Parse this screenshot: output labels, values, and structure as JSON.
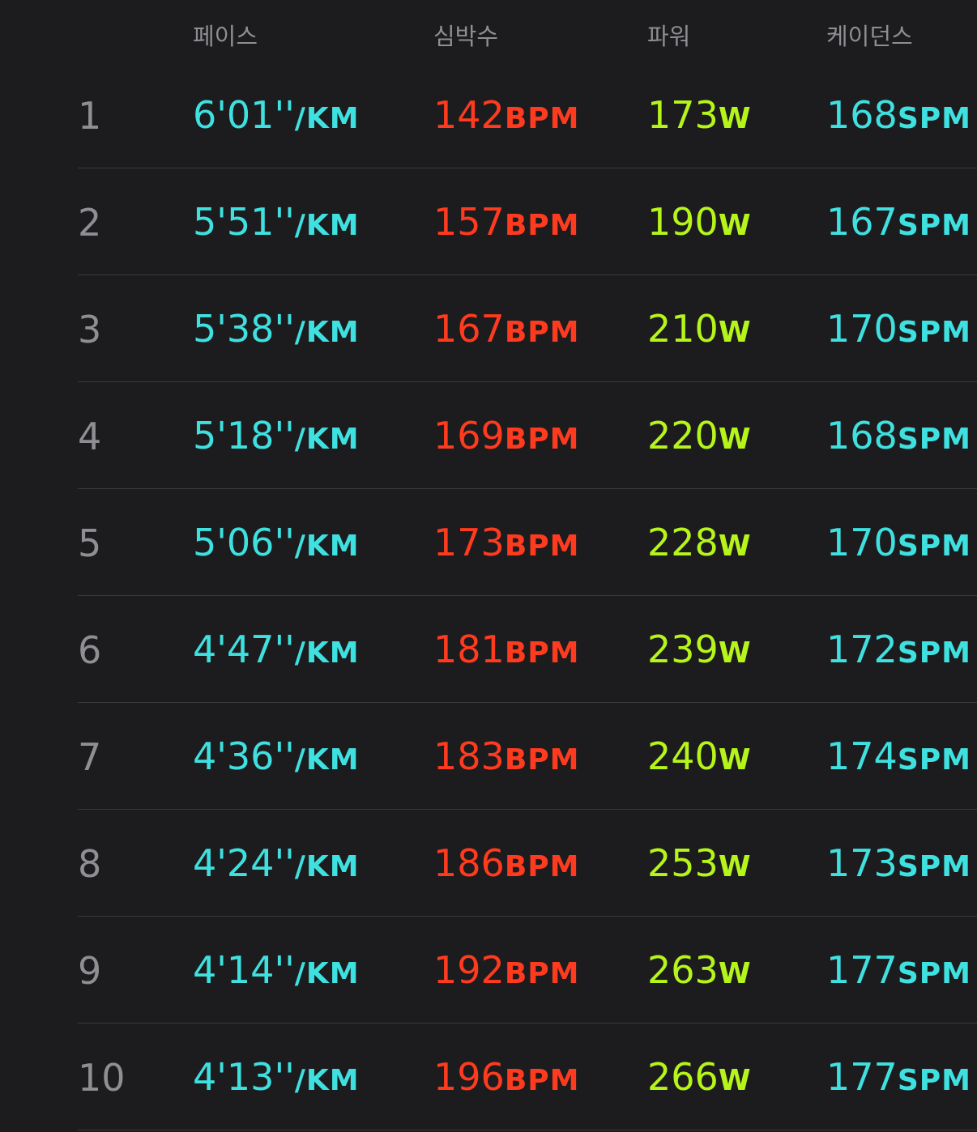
{
  "headers": {
    "pace": "페이스",
    "heart_rate": "심박수",
    "power": "파워",
    "cadence": "케이던스"
  },
  "units": {
    "pace": "/KM",
    "heart_rate": "BPM",
    "power": "W",
    "cadence": "SPM"
  },
  "colors": {
    "background": "#1c1c1e",
    "header_text": "#8e8e93",
    "pace": "#3fe0e0",
    "heart_rate": "#ff3b1f",
    "power": "#b6f51a",
    "cadence": "#3fe0e0",
    "divider": "#3a3a3c"
  },
  "splits": [
    {
      "index": "1",
      "pace": "6'01''",
      "heart_rate": "142",
      "power": "173",
      "cadence": "168"
    },
    {
      "index": "2",
      "pace": "5'51''",
      "heart_rate": "157",
      "power": "190",
      "cadence": "167"
    },
    {
      "index": "3",
      "pace": "5'38''",
      "heart_rate": "167",
      "power": "210",
      "cadence": "170"
    },
    {
      "index": "4",
      "pace": "5'18''",
      "heart_rate": "169",
      "power": "220",
      "cadence": "168"
    },
    {
      "index": "5",
      "pace": "5'06''",
      "heart_rate": "173",
      "power": "228",
      "cadence": "170"
    },
    {
      "index": "6",
      "pace": "4'47''",
      "heart_rate": "181",
      "power": "239",
      "cadence": "172"
    },
    {
      "index": "7",
      "pace": "4'36''",
      "heart_rate": "183",
      "power": "240",
      "cadence": "174"
    },
    {
      "index": "8",
      "pace": "4'24''",
      "heart_rate": "186",
      "power": "253",
      "cadence": "173"
    },
    {
      "index": "9",
      "pace": "4'14''",
      "heart_rate": "192",
      "power": "263",
      "cadence": "177"
    },
    {
      "index": "10",
      "pace": "4'13''",
      "heart_rate": "196",
      "power": "266",
      "cadence": "177"
    }
  ]
}
